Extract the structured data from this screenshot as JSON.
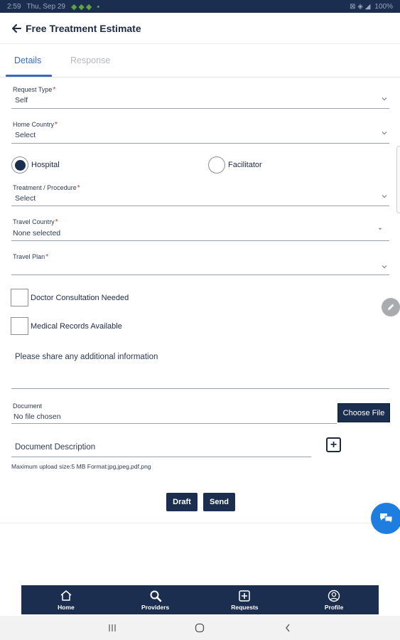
{
  "status_bar": {
    "time": "2:59",
    "date": "Thu, Sep 29",
    "battery": "100%"
  },
  "header": {
    "title": "Free Treatment Estimate",
    "back_icon": "arrow-left-icon"
  },
  "tabs": [
    {
      "label": "Details",
      "active": true
    },
    {
      "label": "Response",
      "active": false
    }
  ],
  "form": {
    "request_type": {
      "label": "Request Type",
      "value": "Self"
    },
    "home_country": {
      "label": "Home Country",
      "value": "Select"
    },
    "provider_options": [
      {
        "label": "Hospital",
        "selected": true
      },
      {
        "label": "Facilitator",
        "selected": false
      }
    ],
    "treatment": {
      "label": "Treatment / Procedure",
      "value": "Select"
    },
    "travel_country": {
      "label": "Travel Country",
      "value": "None selected"
    },
    "travel_plan": {
      "label": "Travel Plan",
      "value": ""
    },
    "required_marker": "*",
    "checkboxes": [
      {
        "label": "Doctor Consultation Needed",
        "checked": false
      },
      {
        "label": "Medical Records Available",
        "checked": false
      }
    ],
    "additional_info_placeholder": "Please share any additional information",
    "document": {
      "label": "Document",
      "value": "No file chosen",
      "choose_button": "Choose File"
    },
    "document_description_placeholder": "Document Description",
    "add_button": "+",
    "upload_hint": "Maximum upload size:5 MB Format:jpg,jpeg,pdf,png",
    "draft_button": "Draft",
    "send_button": "Send"
  },
  "bottom_nav": [
    {
      "label": "Home",
      "icon": "home-icon"
    },
    {
      "label": "Providers",
      "icon": "search-icon"
    },
    {
      "label": "Requests",
      "icon": "plus-square-icon"
    },
    {
      "label": "Profile",
      "icon": "user-circle-icon"
    }
  ],
  "colors": {
    "primary": "#1b2e4f",
    "accent": "#3a6bb8",
    "required": "#d62d2d",
    "chat": "#1e7ee0"
  }
}
